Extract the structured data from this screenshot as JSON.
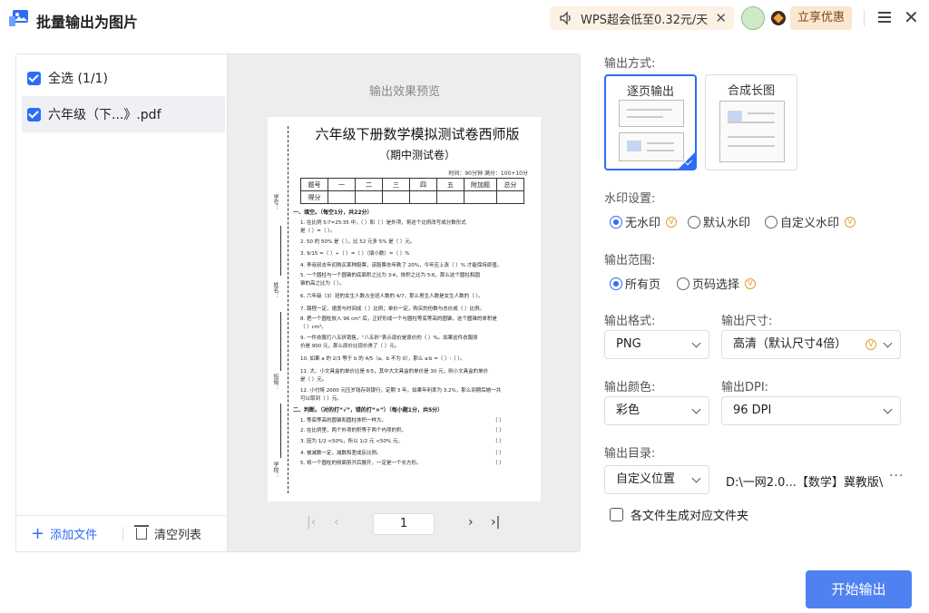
{
  "app": {
    "title": "批量输出为图片"
  },
  "promo": {
    "text": "WPS超会低至0.32元/天",
    "close": "✕"
  },
  "header": {
    "deal_label": "立享优惠",
    "menu_icon": "menu-icon",
    "close_glyph": "✕"
  },
  "file_list": {
    "select_all": "全选 (1/1)",
    "files": [
      {
        "name": "六年级（下...》.pdf",
        "checked": true
      }
    ],
    "add_file": "添加文件",
    "clear_list": "清空列表"
  },
  "preview": {
    "title": "输出效果预览",
    "page_number": "1",
    "doc": {
      "title": "六年级下册数学模拟测试卷西师版",
      "subtitle": "（期中测试卷）",
      "time": "时间：90分钟  满分：100+10分",
      "score_headers": [
        "题号",
        "一",
        "二",
        "三",
        "四",
        "五",
        "附加题",
        "总分"
      ],
      "score_row_label": "得分",
      "side_labels": [
        "学号：",
        "姓名：",
        "班级：",
        "学校："
      ],
      "section1": "一、填空。（每空1分，共22分）",
      "questions": [
        "1.  在比例 5∶7=25∶35 中，（    ）和（    ）是外项，将这个比例改写成分数形式",
        "      是（    ）=（    ）。",
        "2.  50 的 50% 是（    ），比 52 元多 5% 是（    ）元。",
        "3.  9/15 =（    ）÷（    ）=（    ）（填小数）=（    ）%",
        "4.  李叔叔去年初购买某种股票，该股票去年跌了 20%，今年应上涨（    ）% 才能保持原值。",
        "5.  一个圆柱与一个圆锥的底面积之比为 3∶4，体积之比为 5∶6，那么这个圆柱和圆",
        "      锥的高之比为（    ）。",
        "6.  六年级（3）班的女生人数占全班人数的 4/7，那么男生人数是女生人数的（    ）。",
        "7.  路程一定，速度与时间成（    ）比例；单价一定，购买的份数与总价成（    ）比例。",
        "8.  把一个圆柱放入 96 cm³ 后，正好形成一个与圆柱等底等高的圆锥，这个圆锥的体积是",
        "      （    ）cm³。",
        "9.  一件衣服打八五折销售，“八五折”表示现价是原价的（    ）%。如果这件衣服原",
        "      价是 900 元，那么原价比现价贵了（    ）元。",
        "10.  如果 a 的 2/3 等于 b 的 4/5（a、b 不为 0），那么 a∶b =（    ）∶（    ）。",
        "11.  大、小文具盒的单价比是 6∶5，其中大文具盒的单价是 30 元，则小文具盒的单价",
        "      是（    ）元。",
        "12.  小付将 2000 元压岁钱存到银行，定期 3 年，如果年利率为 3.2%，那么到期后她一共",
        "      可以取到（    ）元。"
      ],
      "section2": "二、判断。（对的打“√”，错的打“×”）（每小题1分，共5分）",
      "judgments": [
        "1.  等底等高的圆锥和圆柱体积一样大。",
        "2.  在比例里，两个外项的积等于两个内项的积。",
        "3.  因为 1/2 <50%，所以 1/2 元 <50% 元。",
        "4.  被减数一定，减数和差成反比例。",
        "5.  将一个圆柱的侧面剪开后展开，一定是一个长方形。"
      ],
      "judgment_paren": "（    ）"
    }
  },
  "settings": {
    "output_mode_label": "输出方式:",
    "modes": [
      "逐页输出",
      "合成长图"
    ],
    "watermark_label": "水印设置:",
    "watermark_options": [
      "无水印",
      "默认水印",
      "自定义水印"
    ],
    "range_label": "输出范围:",
    "range_options": [
      "所有页",
      "页码选择"
    ],
    "format_label": "输出格式:",
    "format_value": "PNG",
    "size_label": "输出尺寸:",
    "size_value": "高清（默认尺寸4倍）",
    "color_label": "输出颜色:",
    "color_value": "彩色",
    "dpi_label": "输出DPI:",
    "dpi_value": "96 DPI",
    "dir_label": "输出目录:",
    "dir_mode": "自定义位置",
    "dir_path": "D:\\一网2.0...【数学】冀教版\\",
    "dir_more": "···",
    "per_file_folder": "各文件生成对应文件夹",
    "start_button": "开始输出",
    "vip_badge": "V"
  },
  "colors": {
    "accent": "#2f6cf5",
    "start_button": "#4f82f0",
    "promo_bg": "#fdf1e3",
    "deal_bg": "#fbe7cf"
  }
}
